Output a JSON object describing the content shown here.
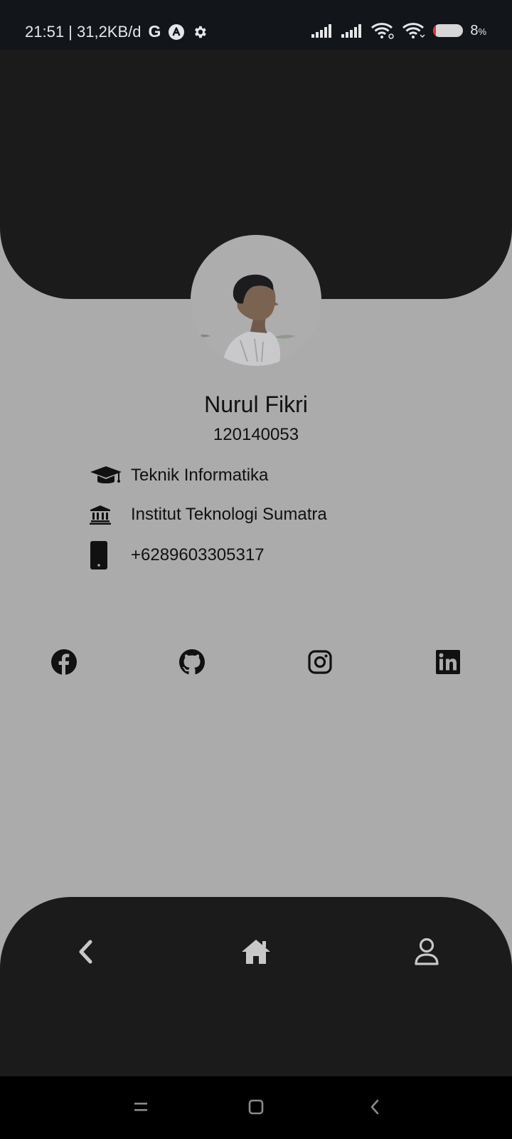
{
  "status_bar": {
    "time_speed": "21:51 | 31,2KB/d",
    "g_logo": "G",
    "battery_percent": "8",
    "battery_unit": "%",
    "battery_level": 0.08,
    "icons": [
      "google-icon",
      "app-a-icon",
      "settings-gear-icon",
      "signal-icon",
      "signal-icon",
      "wifi-icon",
      "wifi-icon",
      "battery-icon"
    ]
  },
  "profile": {
    "name": "Nurul Fikri",
    "nim": "120140053",
    "details": [
      {
        "icon": "graduation-cap-icon",
        "text": "Teknik Informatika"
      },
      {
        "icon": "university-icon",
        "text": "Institut Teknologi Sumatra"
      },
      {
        "icon": "phone-icon",
        "text": "+6289603305317"
      }
    ]
  },
  "social_links": [
    "facebook-icon",
    "github-icon",
    "instagram-icon",
    "linkedin-icon"
  ],
  "bottom_nav": [
    "back-icon",
    "home-icon",
    "profile-icon"
  ],
  "system_nav": [
    "menu-icon",
    "home-square-icon",
    "back-chevron-icon"
  ],
  "colors": {
    "background": "#ababab",
    "header": "#1b1b1b",
    "status_bar": "#12151a",
    "nav_icon": "#c8c8c8"
  }
}
